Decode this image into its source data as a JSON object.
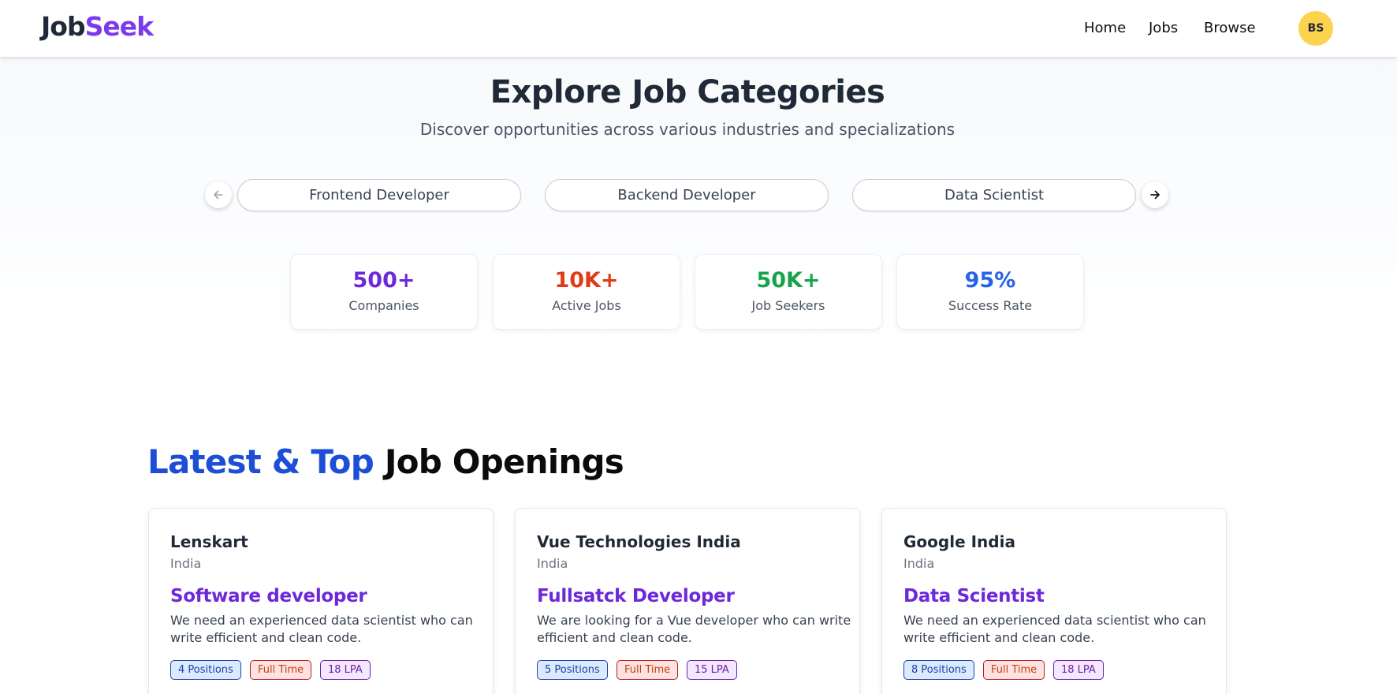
{
  "header": {
    "logo_part1": "Job",
    "logo_part2": "Seek",
    "nav": [
      "Home",
      "Jobs",
      "Browse"
    ],
    "avatar_initials": "BS"
  },
  "hero": {
    "title": "Explore Job Categories",
    "subtitle": "Discover opportunities across various industries and specializations",
    "categories": [
      "Frontend Developer",
      "Backend Developer",
      "Data Scientist"
    ]
  },
  "stats": [
    {
      "value": "500+",
      "label": "Companies",
      "color": "#6d28d9"
    },
    {
      "value": "10K+",
      "label": "Active Jobs",
      "color": "#e03a16"
    },
    {
      "value": "50K+",
      "label": "Job Seekers",
      "color": "#16a34a"
    },
    {
      "value": "95%",
      "label": "Success Rate",
      "color": "#2563eb"
    }
  ],
  "latest": {
    "title_accent": "Latest & Top",
    "title_rest": "Job Openings",
    "jobs": [
      {
        "company": "Lenskart",
        "location": "India",
        "title": "Software developer",
        "description": "We need an experienced data scientist who can write efficient and clean code.",
        "positions": "4 Positions",
        "type": "Full Time",
        "salary": "18 LPA"
      },
      {
        "company": "Vue Technologies India",
        "location": "India",
        "title": "Fullsatck Developer",
        "description": "We are looking for a Vue developer who can write efficient and clean code.",
        "positions": "5 Positions",
        "type": "Full Time",
        "salary": "15 LPA"
      },
      {
        "company": "Google India",
        "location": "India",
        "title": "Data Scientist",
        "description": "We need an experienced data scientist who can write efficient and clean code.",
        "positions": "8 Positions",
        "type": "Full Time",
        "salary": "18 LPA"
      }
    ]
  },
  "icons": {
    "prev": "arrow-left-icon",
    "next": "arrow-right-icon"
  }
}
